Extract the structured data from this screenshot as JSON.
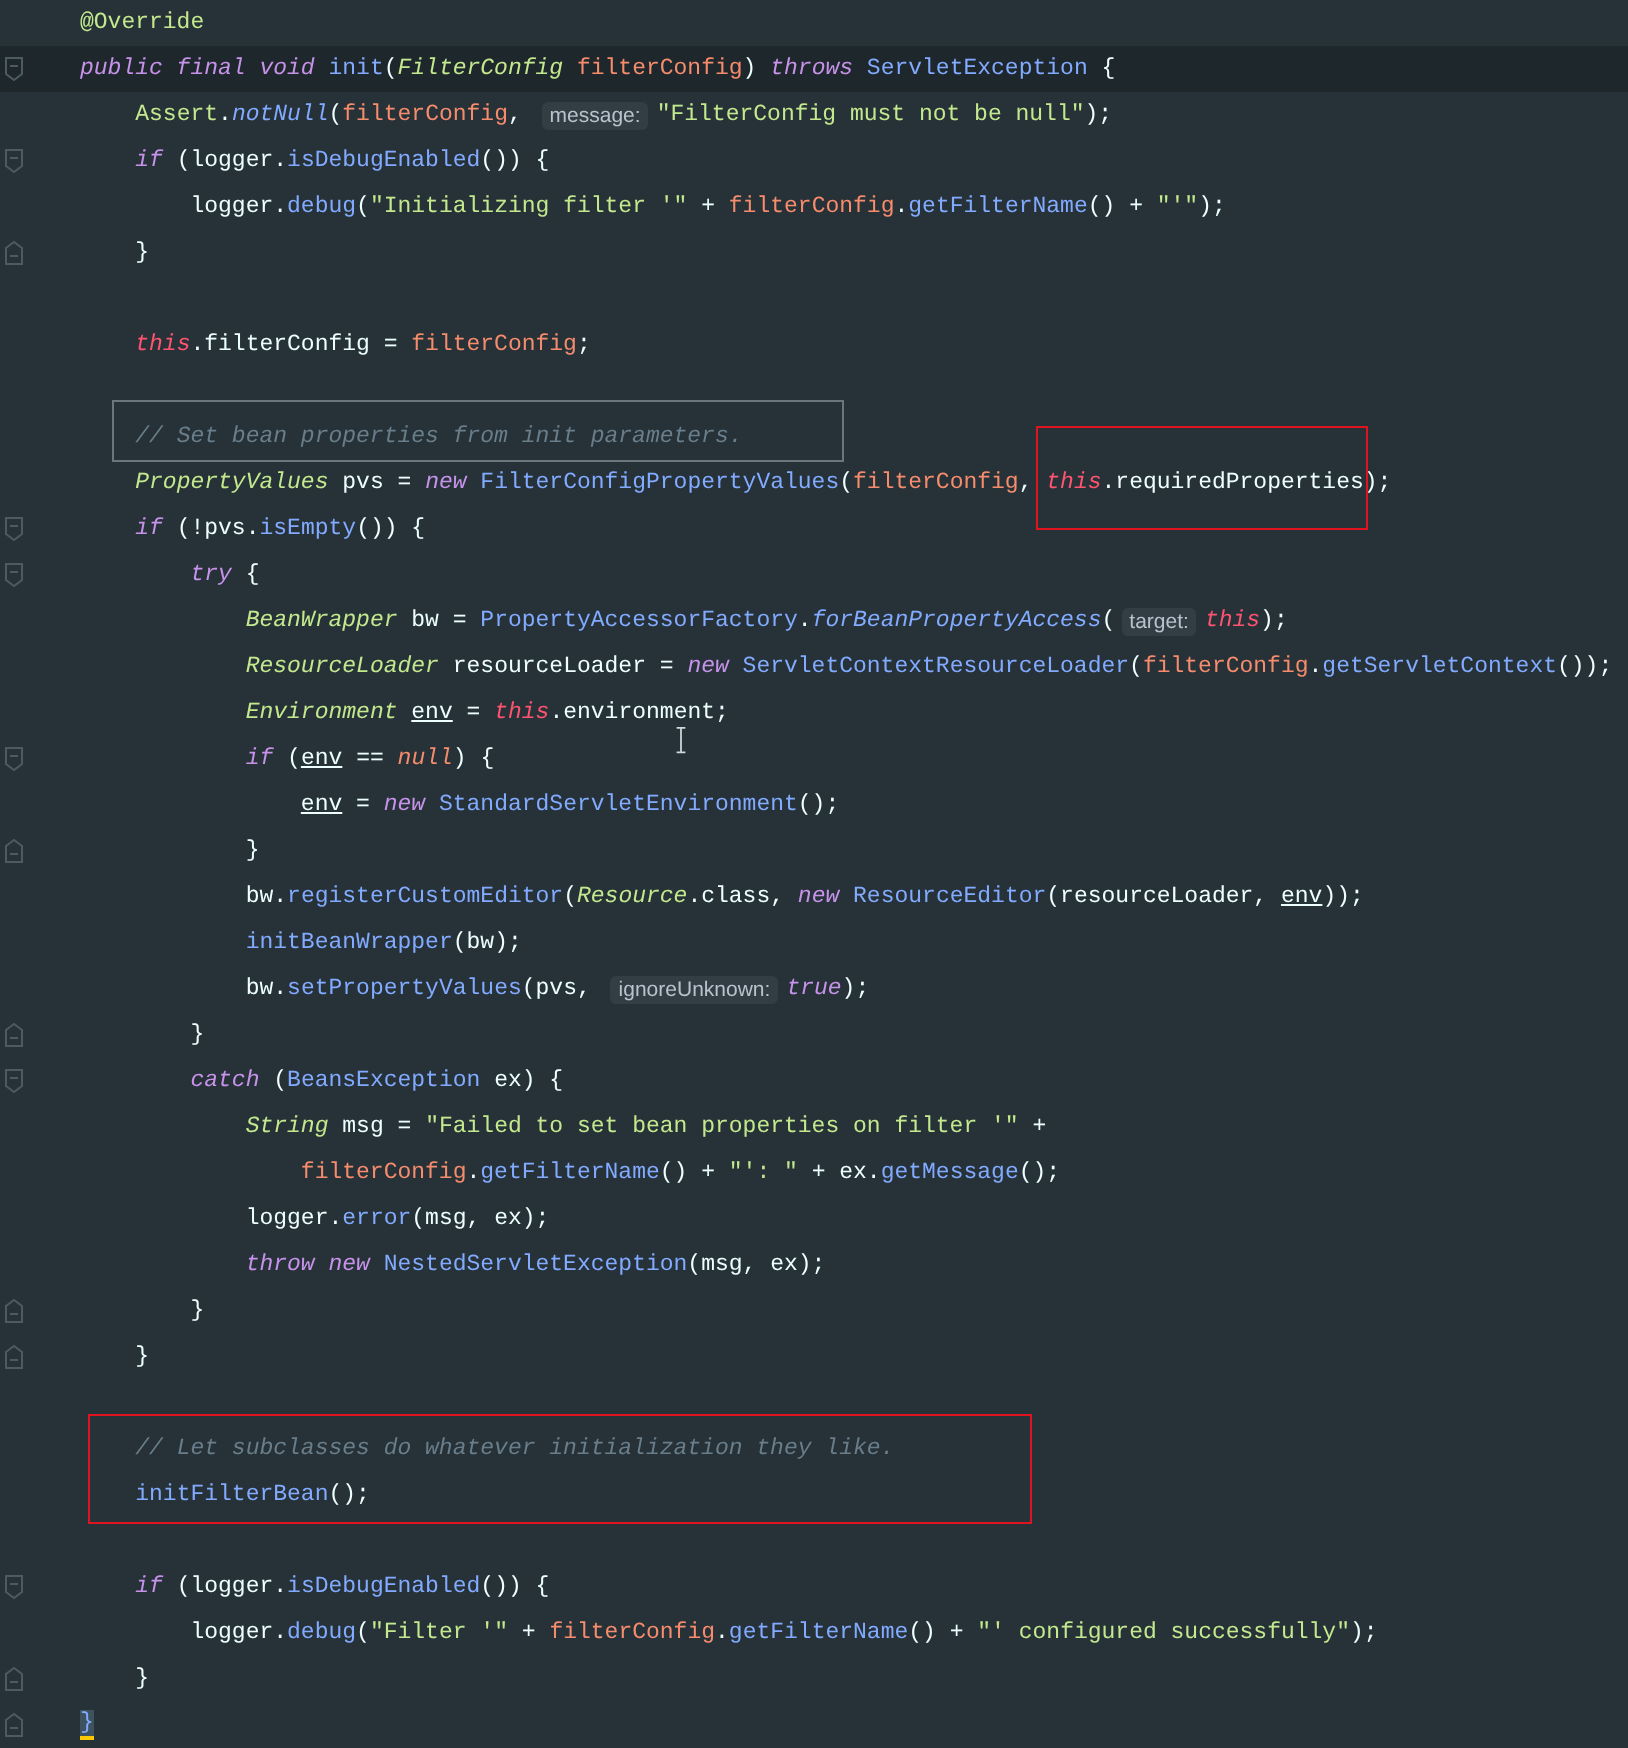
{
  "editor": {
    "lines": [
      {
        "current": false,
        "fold_start": false,
        "fold_end": false,
        "tokens": [
          {
            "text": "@Override",
            "kind": "annotation"
          }
        ]
      },
      {
        "current": true,
        "fold_start": true,
        "fold_end": false,
        "tokens": [
          {
            "text": "public final void ",
            "kind": "keyword"
          },
          {
            "text": "init",
            "kind": "method"
          },
          {
            "text": "(",
            "kind": "plain"
          },
          {
            "text": "FilterConfig ",
            "kind": "type"
          },
          {
            "text": "filterConfig",
            "kind": "param"
          },
          {
            "text": ") ",
            "kind": "plain"
          },
          {
            "text": "throws ",
            "kind": "keyword"
          },
          {
            "text": "ServletException",
            "kind": "class"
          },
          {
            "text": " {",
            "kind": "plain"
          }
        ]
      },
      {
        "current": false,
        "fold_start": false,
        "fold_end": false,
        "tokens": [
          {
            "text": "    Assert",
            "kind": "type-plain"
          },
          {
            "text": ".",
            "kind": "plain"
          },
          {
            "text": "notNull",
            "kind": "static"
          },
          {
            "text": "(",
            "kind": "plain"
          },
          {
            "text": "filterConfig",
            "kind": "param"
          },
          {
            "text": ", ",
            "kind": "plain"
          },
          {
            "text": "message:",
            "kind": "hint"
          },
          {
            "text": "\"FilterConfig must not be null\"",
            "kind": "string"
          },
          {
            "text": ");",
            "kind": "plain"
          }
        ]
      },
      {
        "current": false,
        "fold_start": true,
        "fold_end": false,
        "tokens": [
          {
            "text": "    if ",
            "kind": "keyword"
          },
          {
            "text": "(logger.",
            "kind": "plain"
          },
          {
            "text": "isDebugEnabled",
            "kind": "method"
          },
          {
            "text": "()) {",
            "kind": "plain"
          }
        ]
      },
      {
        "current": false,
        "fold_start": false,
        "fold_end": false,
        "tokens": [
          {
            "text": "        logger.",
            "kind": "plain"
          },
          {
            "text": "debug",
            "kind": "method"
          },
          {
            "text": "(",
            "kind": "plain"
          },
          {
            "text": "\"Initializing filter '\"",
            "kind": "string"
          },
          {
            "text": " + ",
            "kind": "plain"
          },
          {
            "text": "filterConfig",
            "kind": "param"
          },
          {
            "text": ".",
            "kind": "plain"
          },
          {
            "text": "getFilterName",
            "kind": "method"
          },
          {
            "text": "() + ",
            "kind": "plain"
          },
          {
            "text": "\"'\"",
            "kind": "string"
          },
          {
            "text": ");",
            "kind": "plain"
          }
        ]
      },
      {
        "current": false,
        "fold_start": false,
        "fold_end": true,
        "tokens": [
          {
            "text": "    }",
            "kind": "plain"
          }
        ]
      },
      {
        "current": false,
        "fold_start": false,
        "fold_end": false
      },
      {
        "current": false,
        "fold_start": false,
        "fold_end": false,
        "tokens": [
          {
            "text": "    this",
            "kind": "this"
          },
          {
            "text": ".filterConfig = ",
            "kind": "plain"
          },
          {
            "text": "filterConfig",
            "kind": "param"
          },
          {
            "text": ";",
            "kind": "plain"
          }
        ]
      },
      {
        "current": false,
        "fold_start": false,
        "fold_end": false
      },
      {
        "current": false,
        "fold_start": false,
        "fold_end": false,
        "tokens": [
          {
            "text": "    // Set bean properties from init parameters.",
            "kind": "comment"
          }
        ]
      },
      {
        "current": false,
        "fold_start": false,
        "fold_end": false,
        "tokens": [
          {
            "text": "    PropertyValues ",
            "kind": "type"
          },
          {
            "text": "pvs = ",
            "kind": "plain"
          },
          {
            "text": "new ",
            "kind": "keyword"
          },
          {
            "text": "FilterConfigPropertyValues",
            "kind": "class"
          },
          {
            "text": "(",
            "kind": "plain"
          },
          {
            "text": "filterConfig",
            "kind": "param"
          },
          {
            "text": ", ",
            "kind": "plain"
          },
          {
            "text": "this",
            "kind": "this"
          },
          {
            "text": ".requiredProperties);",
            "kind": "plain"
          }
        ]
      },
      {
        "current": false,
        "fold_start": true,
        "fold_end": false,
        "tokens": [
          {
            "text": "    if ",
            "kind": "keyword"
          },
          {
            "text": "(!pvs.",
            "kind": "plain"
          },
          {
            "text": "isEmpty",
            "kind": "method"
          },
          {
            "text": "()) {",
            "kind": "plain"
          }
        ]
      },
      {
        "current": false,
        "fold_start": true,
        "fold_end": false,
        "tokens": [
          {
            "text": "        try ",
            "kind": "keyword"
          },
          {
            "text": "{",
            "kind": "plain"
          }
        ]
      },
      {
        "current": false,
        "fold_start": false,
        "fold_end": false,
        "tokens": [
          {
            "text": "            BeanWrapper ",
            "kind": "type"
          },
          {
            "text": "bw = ",
            "kind": "plain"
          },
          {
            "text": "PropertyAccessorFactory",
            "kind": "class"
          },
          {
            "text": ".",
            "kind": "plain"
          },
          {
            "text": "forBeanPropertyAccess",
            "kind": "static"
          },
          {
            "text": "(",
            "kind": "plain"
          },
          {
            "text": "target:",
            "kind": "hint"
          },
          {
            "text": "this",
            "kind": "this"
          },
          {
            "text": ");",
            "kind": "plain"
          }
        ]
      },
      {
        "current": false,
        "fold_start": false,
        "fold_end": false,
        "tokens": [
          {
            "text": "            ResourceLoader ",
            "kind": "type"
          },
          {
            "text": "resourceLoader = ",
            "kind": "plain"
          },
          {
            "text": "new ",
            "kind": "keyword"
          },
          {
            "text": "ServletContextResourceLoader",
            "kind": "class"
          },
          {
            "text": "(",
            "kind": "plain"
          },
          {
            "text": "filterConfig",
            "kind": "param"
          },
          {
            "text": ".",
            "kind": "plain"
          },
          {
            "text": "getServletContext",
            "kind": "method"
          },
          {
            "text": "());",
            "kind": "plain"
          }
        ]
      },
      {
        "current": false,
        "fold_start": false,
        "fold_end": false,
        "tokens": [
          {
            "text": "            Environment ",
            "kind": "type"
          },
          {
            "text": "env",
            "kind": "local"
          },
          {
            "text": " = ",
            "kind": "plain"
          },
          {
            "text": "this",
            "kind": "this"
          },
          {
            "text": ".environment;",
            "kind": "plain"
          }
        ]
      },
      {
        "current": false,
        "fold_start": true,
        "fold_end": false,
        "tokens": [
          {
            "text": "            if ",
            "kind": "keyword"
          },
          {
            "text": "(",
            "kind": "plain"
          },
          {
            "text": "env",
            "kind": "local"
          },
          {
            "text": " == ",
            "kind": "plain"
          },
          {
            "text": "null",
            "kind": "literal"
          },
          {
            "text": ") {",
            "kind": "plain"
          }
        ]
      },
      {
        "current": false,
        "fold_start": false,
        "fold_end": false,
        "tokens": [
          {
            "text": "                env",
            "kind": "local"
          },
          {
            "text": " = ",
            "kind": "plain"
          },
          {
            "text": "new ",
            "kind": "keyword"
          },
          {
            "text": "StandardServletEnvironment",
            "kind": "class"
          },
          {
            "text": "();",
            "kind": "plain"
          }
        ]
      },
      {
        "current": false,
        "fold_start": false,
        "fold_end": true,
        "tokens": [
          {
            "text": "            }",
            "kind": "plain"
          }
        ]
      },
      {
        "current": false,
        "fold_start": false,
        "fold_end": false,
        "tokens": [
          {
            "text": "            bw.",
            "kind": "plain"
          },
          {
            "text": "registerCustomEditor",
            "kind": "method"
          },
          {
            "text": "(",
            "kind": "plain"
          },
          {
            "text": "Resource",
            "kind": "type"
          },
          {
            "text": ".class, ",
            "kind": "plain"
          },
          {
            "text": "new ",
            "kind": "keyword"
          },
          {
            "text": "ResourceEditor",
            "kind": "class"
          },
          {
            "text": "(resourceLoader, ",
            "kind": "plain"
          },
          {
            "text": "env",
            "kind": "local"
          },
          {
            "text": "));",
            "kind": "plain"
          }
        ]
      },
      {
        "current": false,
        "fold_start": false,
        "fold_end": false,
        "tokens": [
          {
            "text": "            initBeanWrapper",
            "kind": "method"
          },
          {
            "text": "(bw);",
            "kind": "plain"
          }
        ]
      },
      {
        "current": false,
        "fold_start": false,
        "fold_end": false,
        "tokens": [
          {
            "text": "            bw.",
            "kind": "plain"
          },
          {
            "text": "setPropertyValues",
            "kind": "method"
          },
          {
            "text": "(pvs, ",
            "kind": "plain"
          },
          {
            "text": "ignoreUnknown:",
            "kind": "hint"
          },
          {
            "text": "true",
            "kind": "literal-kw"
          },
          {
            "text": ");",
            "kind": "plain"
          }
        ]
      },
      {
        "current": false,
        "fold_start": false,
        "fold_end": true,
        "tokens": [
          {
            "text": "        }",
            "kind": "plain"
          }
        ]
      },
      {
        "current": false,
        "fold_start": true,
        "fold_end": false,
        "tokens": [
          {
            "text": "        catch ",
            "kind": "keyword"
          },
          {
            "text": "(",
            "kind": "plain"
          },
          {
            "text": "BeansException ",
            "kind": "class"
          },
          {
            "text": "ex) {",
            "kind": "plain"
          }
        ]
      },
      {
        "current": false,
        "fold_start": false,
        "fold_end": false,
        "tokens": [
          {
            "text": "            String ",
            "kind": "type"
          },
          {
            "text": "msg = ",
            "kind": "plain"
          },
          {
            "text": "\"Failed to set bean properties on filter '\"",
            "kind": "string"
          },
          {
            "text": " +",
            "kind": "plain"
          }
        ]
      },
      {
        "current": false,
        "fold_start": false,
        "fold_end": false,
        "tokens": [
          {
            "text": "                filterConfig",
            "kind": "param"
          },
          {
            "text": ".",
            "kind": "plain"
          },
          {
            "text": "getFilterName",
            "kind": "method"
          },
          {
            "text": "() + ",
            "kind": "plain"
          },
          {
            "text": "\"': \"",
            "kind": "string"
          },
          {
            "text": " + ex.",
            "kind": "plain"
          },
          {
            "text": "getMessage",
            "kind": "method"
          },
          {
            "text": "();",
            "kind": "plain"
          }
        ]
      },
      {
        "current": false,
        "fold_start": false,
        "fold_end": false,
        "tokens": [
          {
            "text": "            logger.",
            "kind": "plain"
          },
          {
            "text": "error",
            "kind": "method"
          },
          {
            "text": "(msg, ex);",
            "kind": "plain"
          }
        ]
      },
      {
        "current": false,
        "fold_start": false,
        "fold_end": false,
        "tokens": [
          {
            "text": "            throw new ",
            "kind": "keyword"
          },
          {
            "text": "NestedServletException",
            "kind": "class"
          },
          {
            "text": "(msg, ex);",
            "kind": "plain"
          }
        ]
      },
      {
        "current": false,
        "fold_start": false,
        "fold_end": true,
        "tokens": [
          {
            "text": "        }",
            "kind": "plain"
          }
        ]
      },
      {
        "current": false,
        "fold_start": false,
        "fold_end": true,
        "tokens": [
          {
            "text": "    }",
            "kind": "plain"
          }
        ]
      },
      {
        "current": false,
        "fold_start": false,
        "fold_end": false
      },
      {
        "current": false,
        "fold_start": false,
        "fold_end": false,
        "tokens": [
          {
            "text": "    // Let subclasses do whatever initialization they like.",
            "kind": "comment"
          }
        ]
      },
      {
        "current": false,
        "fold_start": false,
        "fold_end": false,
        "tokens": [
          {
            "text": "    initFilterBean",
            "kind": "method"
          },
          {
            "text": "();",
            "kind": "plain"
          }
        ]
      },
      {
        "current": false,
        "fold_start": false,
        "fold_end": false
      },
      {
        "current": false,
        "fold_start": true,
        "fold_end": false,
        "tokens": [
          {
            "text": "    if ",
            "kind": "keyword"
          },
          {
            "text": "(logger.",
            "kind": "plain"
          },
          {
            "text": "isDebugEnabled",
            "kind": "method"
          },
          {
            "text": "()) {",
            "kind": "plain"
          }
        ]
      },
      {
        "current": false,
        "fold_start": false,
        "fold_end": false,
        "tokens": [
          {
            "text": "        logger.",
            "kind": "plain"
          },
          {
            "text": "debug",
            "kind": "method"
          },
          {
            "text": "(",
            "kind": "plain"
          },
          {
            "text": "\"Filter '\"",
            "kind": "string"
          },
          {
            "text": " + ",
            "kind": "plain"
          },
          {
            "text": "filterConfig",
            "kind": "param"
          },
          {
            "text": ".",
            "kind": "plain"
          },
          {
            "text": "getFilterName",
            "kind": "method"
          },
          {
            "text": "() + ",
            "kind": "plain"
          },
          {
            "text": "\"' configured successfully\"",
            "kind": "string"
          },
          {
            "text": ");",
            "kind": "plain"
          }
        ]
      },
      {
        "current": false,
        "fold_start": false,
        "fold_end": true,
        "tokens": [
          {
            "text": "    }",
            "kind": "plain"
          }
        ]
      },
      {
        "current": false,
        "fold_start": false,
        "fold_end": true,
        "tokens": [
          {
            "text": "}",
            "kind": "brace-match"
          }
        ]
      }
    ]
  }
}
